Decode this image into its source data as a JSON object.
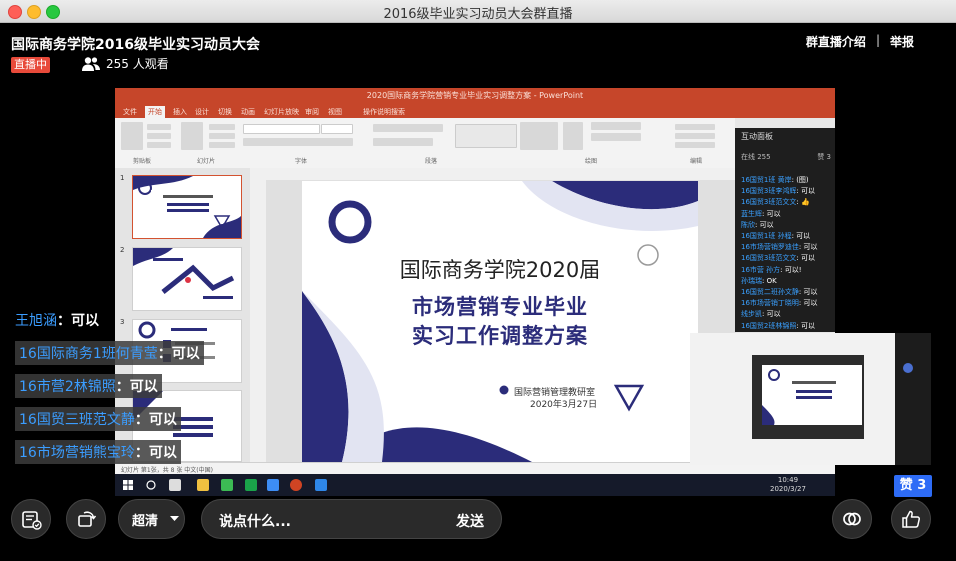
{
  "window": {
    "title": "2016级毕业实习动员大会群直播"
  },
  "header": {
    "title": "国际商务学院2016级毕业实习动员大会",
    "live_badge": "直播中",
    "viewers": "255 人观看",
    "links": [
      "群直播介绍",
      "举报"
    ]
  },
  "screen": {
    "ppt_title": "2020国际商务学院营销专业毕业实习调整方案 - PowerPoint",
    "ribbon_tabs": [
      "文件",
      "开始",
      "插入",
      "设计",
      "切换",
      "动画",
      "幻灯片放映",
      "审阅",
      "视图",
      "操作说明搜索"
    ],
    "ribbon_groups": [
      "剪贴板",
      "幻灯片",
      "字体",
      "段落",
      "绘图",
      "编辑"
    ],
    "slide": {
      "line1": "国际商务学院2020届",
      "line2": "市场营销专业毕业",
      "line3": "实习工作调整方案",
      "org": "国际营销管理教研室",
      "date": "2020年3月27日"
    },
    "thumb_numbers": [
      "1",
      "2",
      "3"
    ],
    "status_text": "幻灯片 第1张，共 8 张    中文(中国)",
    "clock": {
      "time": "10:49",
      "date": "2020/3/27"
    },
    "panel": {
      "title": "互动面板",
      "online": "在线 255",
      "likes": "赞 3",
      "messages": [
        {
          "user": "16国贸1班 黄岸",
          "text": "(图)"
        },
        {
          "user": "16国贸3班李鸿辉",
          "text": "可以"
        },
        {
          "user": "16国贸3班范文文",
          "text": "👍"
        },
        {
          "user": "蓝生辉",
          "text": "可以"
        },
        {
          "user": "陈欣",
          "text": "可以"
        },
        {
          "user": "16国贸1班 孙程",
          "text": "可以"
        },
        {
          "user": "16市场营销罗迪佳",
          "text": "可以"
        },
        {
          "user": "16国贸3班范文文",
          "text": "可以"
        },
        {
          "user": "16市营 孙方",
          "text": "可以!"
        },
        {
          "user": "孙瑞瑞",
          "text": "OK"
        },
        {
          "user": "16国贸二班孙文静",
          "text": "可以"
        },
        {
          "user": "16市场营销丁晓明",
          "text": "可以"
        },
        {
          "user": "线步凯",
          "text": "可以"
        },
        {
          "user": "16国贸2班林锦照",
          "text": "可以"
        }
      ]
    }
  },
  "danmu": [
    {
      "user": "王旭涵",
      "text": "：可以"
    },
    {
      "user": "16国际商务1班何青莹",
      "text": "：可以"
    },
    {
      "user": "16市营2林锦照",
      "text": "：可以"
    },
    {
      "user": "16国贸三班范文静",
      "text": "：可以"
    },
    {
      "user": "16市场营销熊宝玲",
      "text": "：可以"
    }
  ],
  "like_count": "赞 3",
  "bottom": {
    "quality": "超清",
    "chat_placeholder": "说点什么...",
    "send": "发送"
  }
}
